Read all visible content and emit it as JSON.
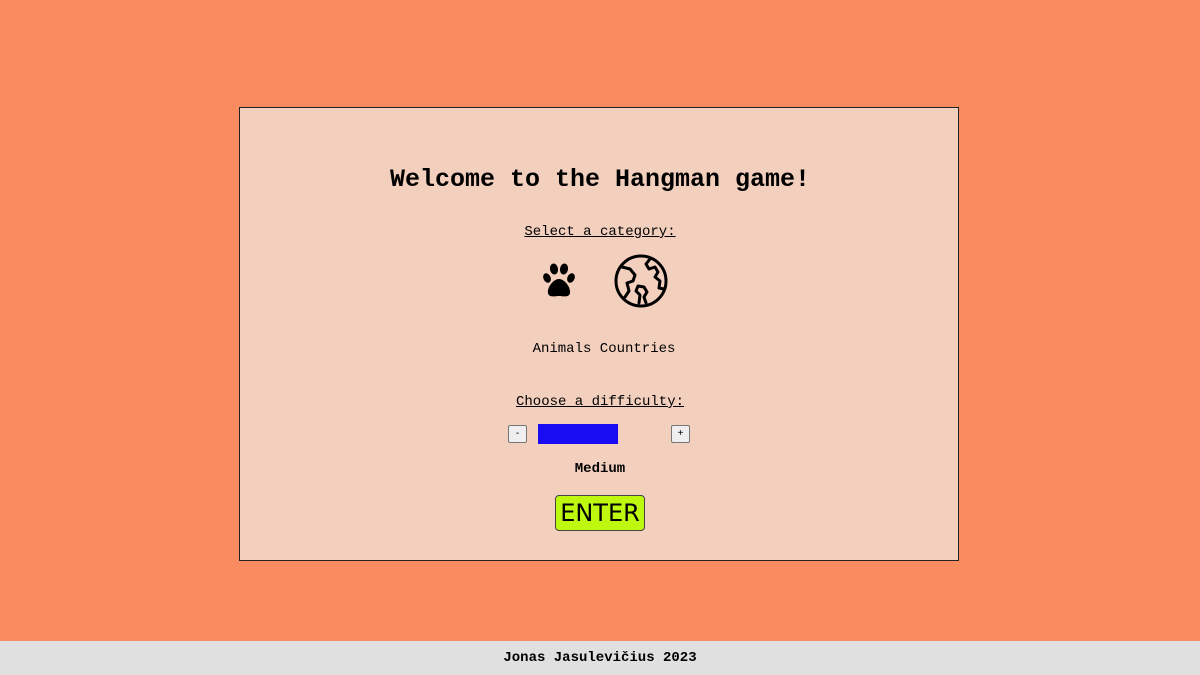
{
  "game": {
    "title": "Welcome to the Hangman game!",
    "category_prompt": "Select a category:",
    "categories": [
      {
        "label": "Animals",
        "icon": "paw-icon"
      },
      {
        "label": "Countries",
        "icon": "globe-icon"
      }
    ],
    "difficulty_prompt": "Choose a difficulty:",
    "decrease_label": "-",
    "increase_label": "+",
    "difficulty_level": 0.67,
    "difficulty_value": "Medium",
    "enter_label": "ENTER"
  },
  "footer": {
    "text": "Jonas Jasulevičius 2023"
  },
  "colors": {
    "background": "#f88c60",
    "panel": "#f3cfbe",
    "meter_fill": "#1a0cf2",
    "enter_button": "#bff80f",
    "footer": "#e0e0e0"
  }
}
